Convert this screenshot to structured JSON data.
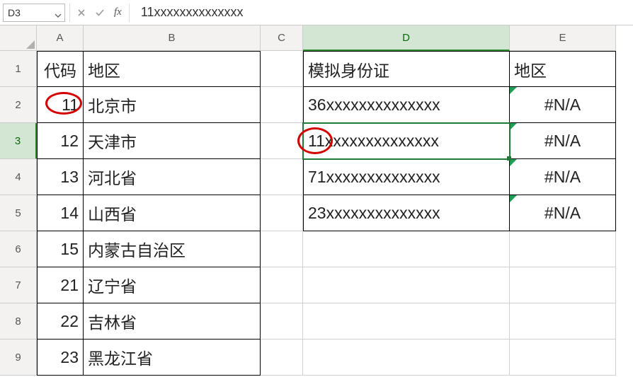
{
  "formula_bar": {
    "name_box": "D3",
    "formula": "11xxxxxxxxxxxxxx"
  },
  "columns": [
    "A",
    "B",
    "C",
    "D",
    "E"
  ],
  "rows": [
    "1",
    "2",
    "3",
    "4",
    "5",
    "6",
    "7",
    "8",
    "9"
  ],
  "tableA": {
    "header": {
      "code": "代码",
      "region": "地区"
    },
    "data": [
      {
        "code": "11",
        "region": "北京市"
      },
      {
        "code": "12",
        "region": "天津市"
      },
      {
        "code": "13",
        "region": "河北省"
      },
      {
        "code": "14",
        "region": "山西省"
      },
      {
        "code": "15",
        "region": "内蒙古自治区"
      },
      {
        "code": "21",
        "region": "辽宁省"
      },
      {
        "code": "22",
        "region": "吉林省"
      },
      {
        "code": "23",
        "region": "黑龙江省"
      }
    ]
  },
  "tableD": {
    "header": {
      "id": "模拟身份证",
      "region": "地区"
    },
    "data": [
      {
        "id": "36xxxxxxxxxxxxxx",
        "region": "#N/A"
      },
      {
        "id": "11xxxxxxxxxxxxxx",
        "region": "#N/A"
      },
      {
        "id": "71xxxxxxxxxxxxxx",
        "region": "#N/A"
      },
      {
        "id": "23xxxxxxxxxxxxxx",
        "region": "#N/A"
      }
    ]
  },
  "active_cell": "D3"
}
